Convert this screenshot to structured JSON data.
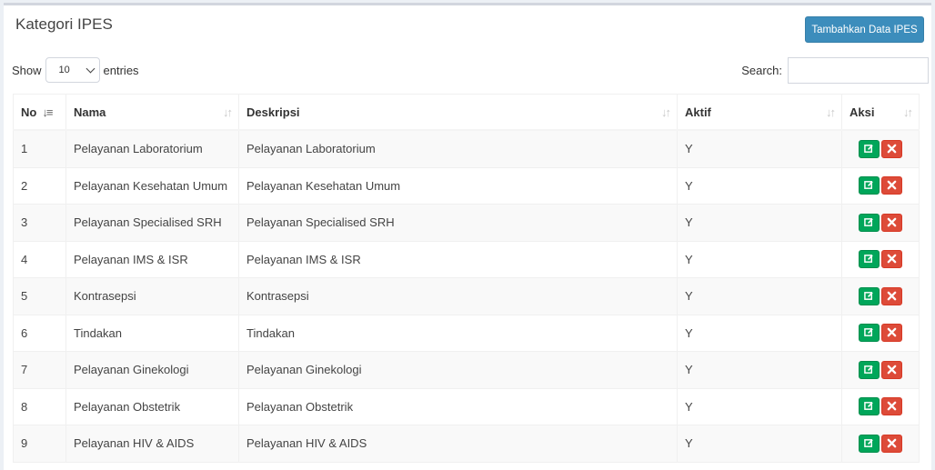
{
  "header": {
    "title": "Kategori IPES",
    "add_button": "Tambahkan Data IPES"
  },
  "controls": {
    "show_label": "Show",
    "length_value": "10",
    "entries_label": "entries",
    "search_label": "Search:",
    "search_value": ""
  },
  "table": {
    "columns": [
      "No",
      "Nama",
      "Deskripsi",
      "Aktif",
      "Aksi"
    ],
    "rows": [
      {
        "no": "1",
        "nama": "Pelayanan Laboratorium",
        "deskripsi": "Pelayanan Laboratorium",
        "aktif": "Y"
      },
      {
        "no": "2",
        "nama": "Pelayanan Kesehatan Umum",
        "deskripsi": "Pelayanan Kesehatan Umum",
        "aktif": "Y"
      },
      {
        "no": "3",
        "nama": "Pelayanan Specialised SRH",
        "deskripsi": "Pelayanan Specialised SRH",
        "aktif": "Y"
      },
      {
        "no": "4",
        "nama": "Pelayanan IMS & ISR",
        "deskripsi": "Pelayanan IMS & ISR",
        "aktif": "Y"
      },
      {
        "no": "5",
        "nama": "Kontrasepsi",
        "deskripsi": "Kontrasepsi",
        "aktif": "Y"
      },
      {
        "no": "6",
        "nama": "Tindakan",
        "deskripsi": "Tindakan",
        "aktif": "Y"
      },
      {
        "no": "7",
        "nama": "Pelayanan Ginekologi",
        "deskripsi": "Pelayanan Ginekologi",
        "aktif": "Y"
      },
      {
        "no": "8",
        "nama": "Pelayanan Obstetrik",
        "deskripsi": "Pelayanan Obstetrik",
        "aktif": "Y"
      },
      {
        "no": "9",
        "nama": "Pelayanan HIV & AIDS",
        "deskripsi": "Pelayanan HIV & AIDS",
        "aktif": "Y"
      }
    ]
  },
  "colors": {
    "primary": "#3c8dbc",
    "success": "#00a65a",
    "danger": "#dd4b39"
  },
  "icons": {
    "sort_active": "sort-amount-asc-icon",
    "sort": "sort-icon",
    "edit": "edit-icon",
    "delete": "close-icon"
  }
}
